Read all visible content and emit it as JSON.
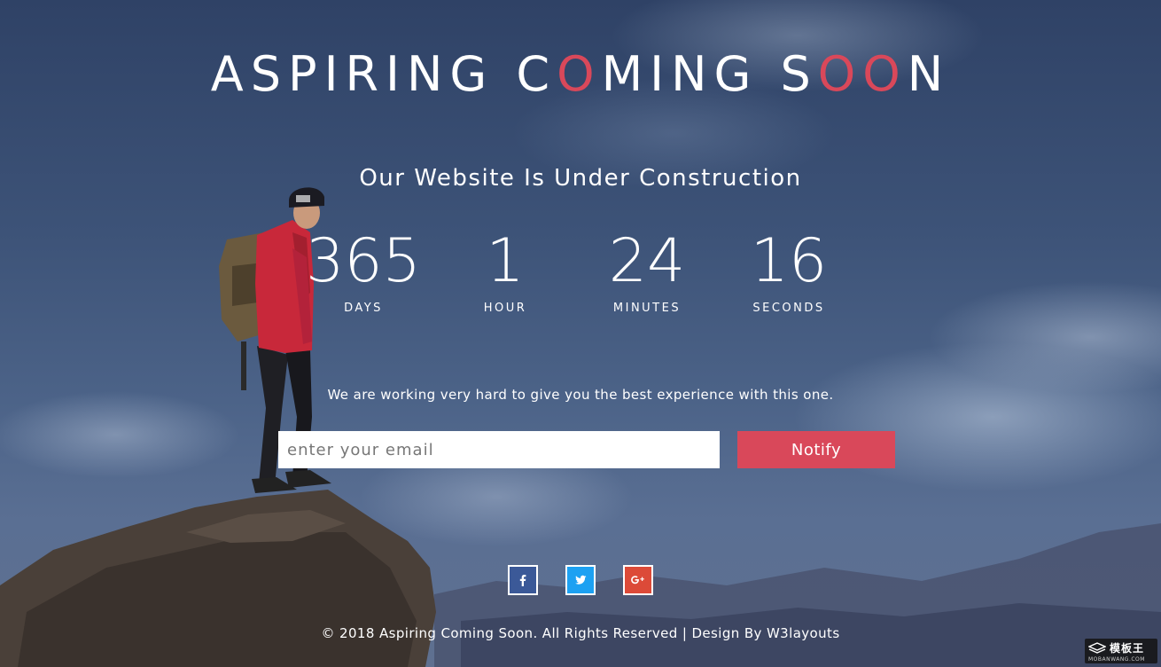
{
  "header": {
    "title_parts": [
      {
        "text": "ASPIRING C",
        "accent": false
      },
      {
        "text": "O",
        "accent": true
      },
      {
        "text": "MING S",
        "accent": false
      },
      {
        "text": "OO",
        "accent": true
      },
      {
        "text": "N",
        "accent": false
      }
    ]
  },
  "subtitle": "Our Website Is Under Construction",
  "countdown": [
    {
      "value": "365",
      "label": "DAYS"
    },
    {
      "value": "1",
      "label": "HOUR"
    },
    {
      "value": "24",
      "label": "MINUTES"
    },
    {
      "value": "16",
      "label": "SECONDS"
    }
  ],
  "message": "We are working very hard to give you the best experience with this one.",
  "subscribe": {
    "placeholder": "enter your email",
    "value": "",
    "button_label": "Notify"
  },
  "social": [
    {
      "name": "facebook",
      "icon": "facebook-icon"
    },
    {
      "name": "twitter",
      "icon": "twitter-icon"
    },
    {
      "name": "google-plus",
      "icon": "google-plus-icon"
    }
  ],
  "footer": "© 2018 Aspiring Coming Soon. All Rights Reserved | Design By W3layouts",
  "watermark": {
    "main": "模板王",
    "sub": "MOBANWANG.COM"
  },
  "colors": {
    "accent": "#d9485a",
    "facebook": "#3b5998",
    "twitter": "#1da1f2",
    "google_plus": "#dc4a38"
  }
}
